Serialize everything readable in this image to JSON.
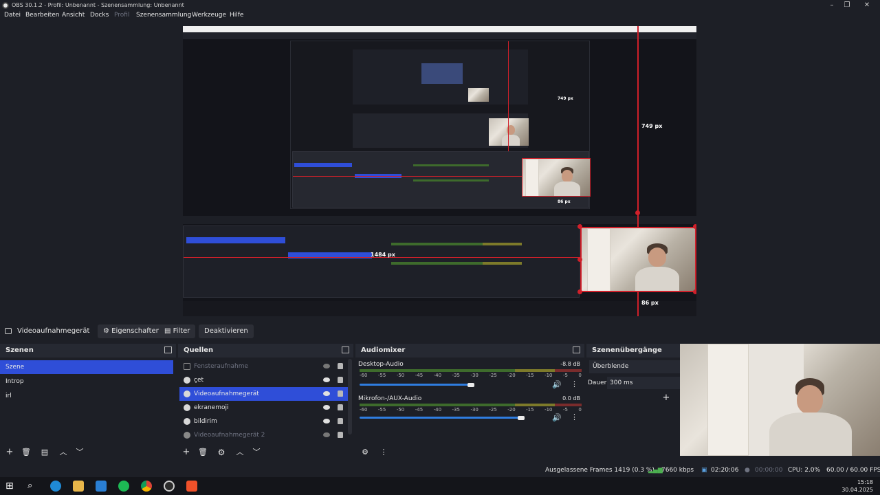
{
  "window": {
    "title": "OBS 30.1.2 - Profil: Unbenannt - Szenensammlung: Unbenannt"
  },
  "menu": [
    {
      "label": "Datei",
      "enabled": true
    },
    {
      "label": "Bearbeiten",
      "enabled": true
    },
    {
      "label": "Ansicht",
      "enabled": true
    },
    {
      "label": "Docks",
      "enabled": true
    },
    {
      "label": "Profil",
      "enabled": false
    },
    {
      "label": "Szenensammlung",
      "enabled": true
    },
    {
      "label": "Werkzeuge",
      "enabled": true
    },
    {
      "label": "Hilfe",
      "enabled": true
    }
  ],
  "preview": {
    "height_label": "749 px",
    "width_label": "1484 px",
    "bottom_label": "86 px",
    "nested_height_label": "749 px",
    "nested_bottom_label": "86 px"
  },
  "source_toolbar": {
    "source_name": "Videoaufnahmegerät",
    "properties_label": "Eigenschaften",
    "filter_label": "Filter",
    "deactivate_label": "Deaktivieren"
  },
  "scenes": {
    "title": "Szenen",
    "items": [
      {
        "label": "Szene",
        "selected": true
      },
      {
        "label": "Introp",
        "selected": false
      },
      {
        "label": "irl",
        "selected": false
      }
    ]
  },
  "sources": {
    "title": "Quellen",
    "items": [
      {
        "label": "Fensteraufnahme",
        "icon": "window-capture-icon",
        "visible": false,
        "selected": false
      },
      {
        "label": "çet",
        "icon": "browser-source-icon",
        "visible": true,
        "selected": false
      },
      {
        "label": "Videoaufnahmegerät",
        "icon": "camera-icon",
        "visible": true,
        "selected": true
      },
      {
        "label": "ekranemoji",
        "icon": "camera-icon",
        "visible": true,
        "selected": false
      },
      {
        "label": "bildirim",
        "icon": "browser-source-icon",
        "visible": true,
        "selected": false
      },
      {
        "label": "Videoaufnahmegerät 2",
        "icon": "camera-icon",
        "visible": false,
        "selected": false
      }
    ]
  },
  "audiomixer": {
    "title": "Audiomixer",
    "ticks": [
      "-60",
      "-55",
      "-50",
      "-45",
      "-40",
      "-35",
      "-30",
      "-25",
      "-20",
      "-15",
      "-10",
      "-5",
      "0"
    ],
    "channels": [
      {
        "name": "Desktop-Audio",
        "level": "-8.8 dB",
        "volume": 0.6
      },
      {
        "name": "Mikrofon-/AUX-Audio",
        "level": "0.0 dB",
        "volume": 0.87
      }
    ]
  },
  "transitions": {
    "title": "Szenenübergänge",
    "transition": "Überblende",
    "duration_label": "Dauer",
    "duration_value": "300 ms"
  },
  "status": {
    "dropped_frames": "Ausgelassene Frames 1419 (0.3 %)",
    "bitrate": "7660 kbps",
    "stream_time": "02:20:06",
    "record_time": "00:00:00",
    "cpu": "CPU: 2.0%",
    "fps": "60.00 / 60.00 FPS"
  },
  "taskbar": {
    "time": "15:18",
    "date": "30.04.2025"
  },
  "colors": {
    "accent": "#2f4ed8",
    "guide_red": "#d0202a",
    "panel": "#1d1f26"
  }
}
